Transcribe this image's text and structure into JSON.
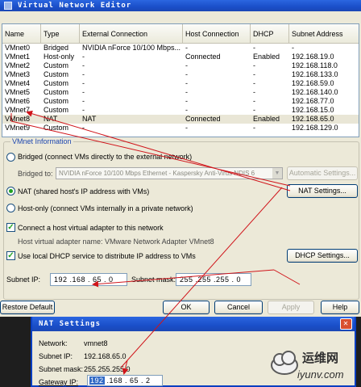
{
  "window": {
    "title": "Virtual Network Editor"
  },
  "table": {
    "headers": [
      "Name",
      "Type",
      "External Connection",
      "Host Connection",
      "DHCP",
      "Subnet Address"
    ],
    "rows": [
      {
        "name": "VMnet0",
        "type": "Bridged",
        "external": "NVIDIA nForce 10/100 Mbps...",
        "host": "-",
        "dhcp": "-",
        "subnet": "-"
      },
      {
        "name": "VMnet1",
        "type": "Host-only",
        "external": "-",
        "host": "Connected",
        "dhcp": "Enabled",
        "subnet": "192.168.19.0"
      },
      {
        "name": "VMnet2",
        "type": "Custom",
        "external": "-",
        "host": "-",
        "dhcp": "-",
        "subnet": "192.168.118.0"
      },
      {
        "name": "VMnet3",
        "type": "Custom",
        "external": "-",
        "host": "-",
        "dhcp": "-",
        "subnet": "192.168.133.0"
      },
      {
        "name": "VMnet4",
        "type": "Custom",
        "external": "-",
        "host": "-",
        "dhcp": "-",
        "subnet": "192.168.59.0"
      },
      {
        "name": "VMnet5",
        "type": "Custom",
        "external": "-",
        "host": "-",
        "dhcp": "-",
        "subnet": "192.168.140.0"
      },
      {
        "name": "VMnet6",
        "type": "Custom",
        "external": "-",
        "host": "-",
        "dhcp": "-",
        "subnet": "192.168.77.0"
      },
      {
        "name": "VMnet7",
        "type": "Custom",
        "external": "-",
        "host": "-",
        "dhcp": "-",
        "subnet": "192.168.15.0"
      },
      {
        "name": "VMnet8",
        "type": "NAT",
        "external": "NAT",
        "host": "Connected",
        "dhcp": "Enabled",
        "subnet": "192.168.65.0"
      },
      {
        "name": "VMnet9",
        "type": "Custom",
        "external": "-",
        "host": "-",
        "dhcp": "-",
        "subnet": "192.168.129.0"
      }
    ],
    "selected_index": 8
  },
  "vmnet_info": {
    "title": "VMnet Information",
    "bridged_label": "Bridged (connect VMs directly to the external network)",
    "bridged_to_label": "Bridged to:",
    "bridged_to_value": "NVIDIA nForce 10/100 Mbps Ethernet  - Kaspersky Anti-Virus NDIS 6",
    "automatic_settings_label": "Automatic Settings...",
    "nat_label": "NAT (shared host's IP address with VMs)",
    "nat_settings_label": "NAT Settings...",
    "hostonly_label": "Host-only (connect VMs internally in a private network)",
    "connect_adapter_label": "Connect a host virtual adapter to this network",
    "adapter_name_label": "Host virtual adapter name: VMware Network Adapter VMnet8",
    "dhcp_label": "Use local DHCP service to distribute IP address to VMs",
    "dhcp_settings_label": "DHCP Settings...",
    "subnet_ip_label": "Subnet IP:",
    "subnet_ip_value": "192 .168 . 65  .  0",
    "subnet_mask_label": "Subnet mask:",
    "subnet_mask_value": "255 .255 .255 .  0",
    "selected_mode": "nat",
    "connect_adapter_checked": true,
    "dhcp_checked": true
  },
  "footer": {
    "restore_default": "Restore Default",
    "ok": "OK",
    "cancel": "Cancel",
    "apply": "Apply",
    "help": "Help"
  },
  "nat_dialog": {
    "title": "NAT Settings",
    "network_label": "Network:",
    "network_value": "vmnet8",
    "subnet_ip_label": "Subnet IP:",
    "subnet_ip_value": "192.168.65.0",
    "subnet_mask_label": "Subnet mask:",
    "subnet_mask_value": "255.255.255.0",
    "gateway_label": "Gateway IP:",
    "gateway_first_octet": "192",
    "gateway_rest": " .168 . 65  .  2"
  },
  "watermark": {
    "brand_cn": "运维网",
    "domain": "iyunv.com"
  },
  "colors": {
    "annotation_red": "#d0141a",
    "title_blue": "#1a4fc9",
    "info_title": "#1c46b0"
  }
}
